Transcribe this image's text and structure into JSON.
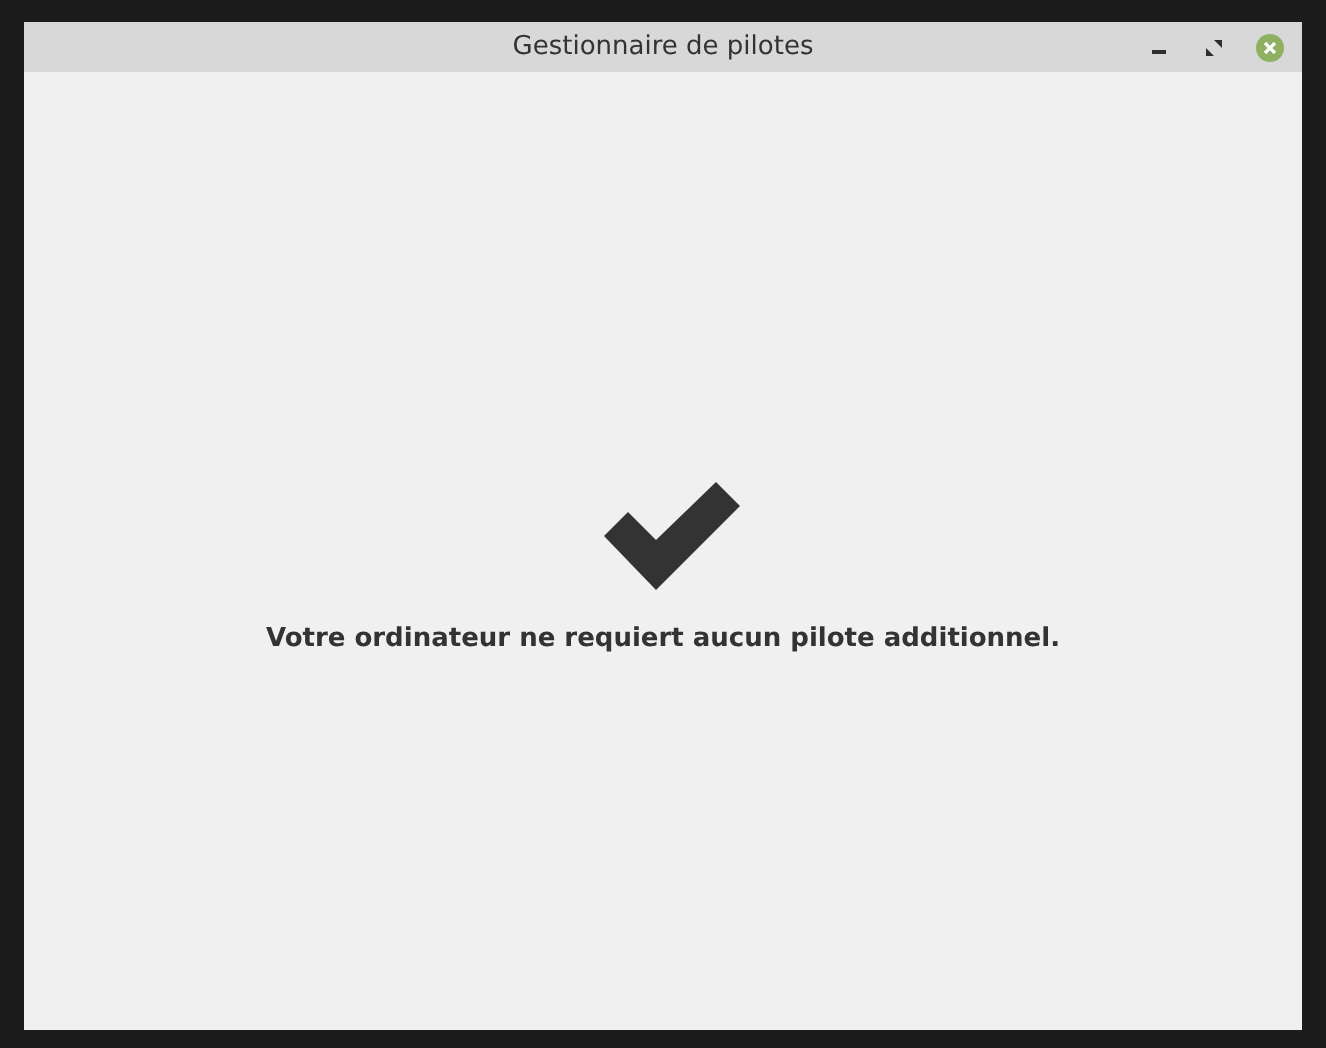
{
  "window": {
    "title": "Gestionnaire de pilotes"
  },
  "message": "Votre ordinateur ne requiert aucun pilote additionnel."
}
